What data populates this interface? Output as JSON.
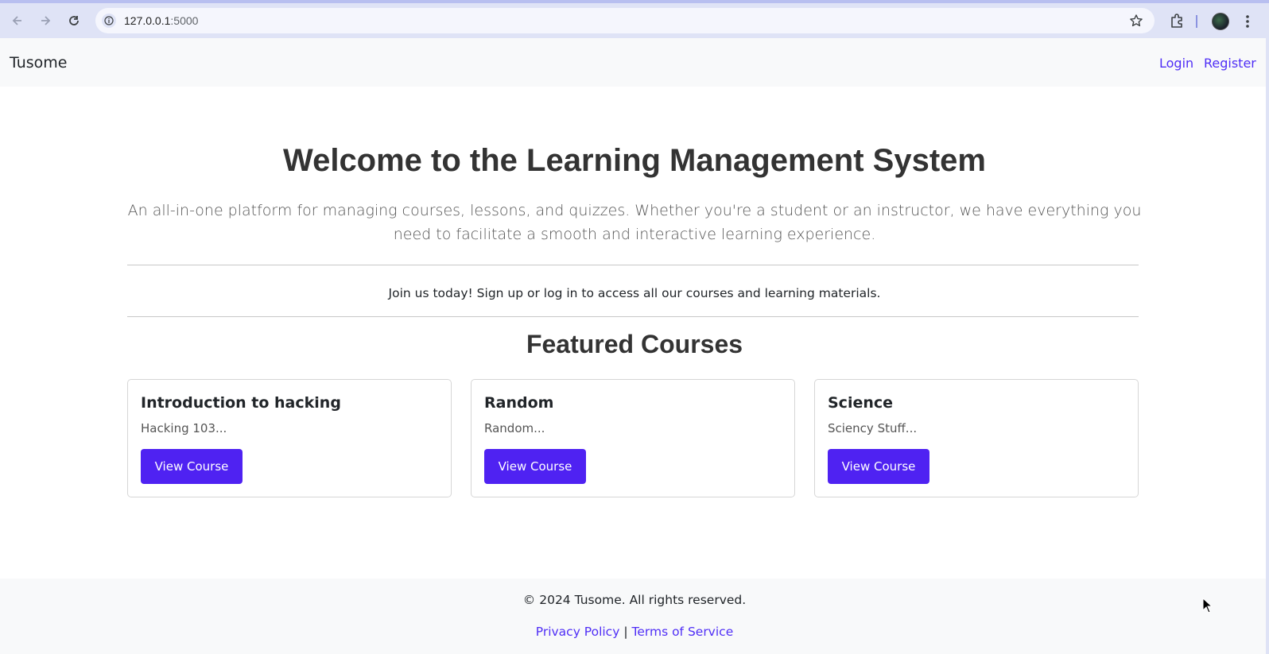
{
  "browser": {
    "url_host": "127.0.0.1",
    "url_port": ":5000",
    "icons": [
      "back-arrow-icon",
      "forward-arrow-icon",
      "reload-icon",
      "site-info-icon",
      "bookmark-star-icon",
      "extensions-puzzle-icon",
      "profile-avatar",
      "menu-kebab-icon"
    ]
  },
  "navbar": {
    "brand": "Tusome",
    "login": "Login",
    "register": "Register"
  },
  "hero": {
    "title": "Welcome to the Learning Management System",
    "lead": "An all-in-one platform for managing courses, lessons, and quizzes. Whether you're a student or an instructor, we have everything you need to facilitate a smooth and interactive learning experience.",
    "join": "Join us today! Sign up or log in to access all our courses and learning materials."
  },
  "featured": {
    "title": "Featured Courses",
    "courses": [
      {
        "title": "Introduction to hacking",
        "description": "Hacking 103...",
        "button": "View Course"
      },
      {
        "title": "Random",
        "description": "Random...",
        "button": "View Course"
      },
      {
        "title": "Science",
        "description": "Sciency Stuff...",
        "button": "View Course"
      }
    ]
  },
  "footer": {
    "copyright": "© 2024 Tusome. All rights reserved.",
    "privacy": "Privacy Policy",
    "separator": "|",
    "terms": "Terms of Service"
  },
  "colors": {
    "accent": "#4f22f2",
    "link": "#4f2ef6",
    "chrome": "#dfe3f6"
  }
}
